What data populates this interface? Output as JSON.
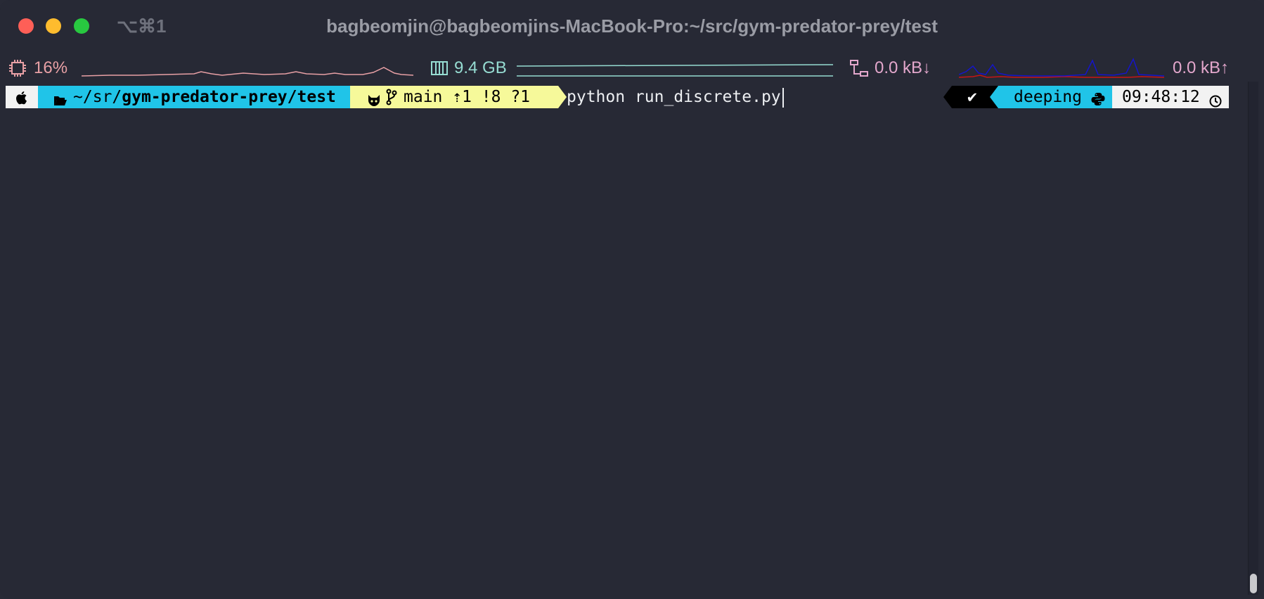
{
  "window": {
    "shortcut": "⌥⌘1",
    "title": "bagbeomjin@bagbeomjins-MacBook-Pro:~/src/gym-predator-prey/test"
  },
  "status": {
    "cpu": "16%",
    "memory": "9.4 GB",
    "net_down": "0.0 kB↓",
    "net_up": "0.0 kB↑",
    "colors": {
      "cpu": "#e8a0a5",
      "memory": "#96dcd2",
      "net": "#e3a7cc",
      "net_graph_down": "#1515c8",
      "net_graph_up": "#c81515"
    }
  },
  "prompt": {
    "apple_icon": "apple-icon",
    "path_prefix": "~/sr/",
    "path_bold": "gym-predator-prey/test",
    "branch": "main",
    "git_status": "⇡1 !8 ?1",
    "command": "python run_discrete.py",
    "status_mark": "✔",
    "env": "deeping",
    "time": "09:48:12",
    "colors": {
      "path_bg": "#20c4e8",
      "git_bg": "#f6f99a",
      "time_bg": "#f2f2f2"
    }
  }
}
